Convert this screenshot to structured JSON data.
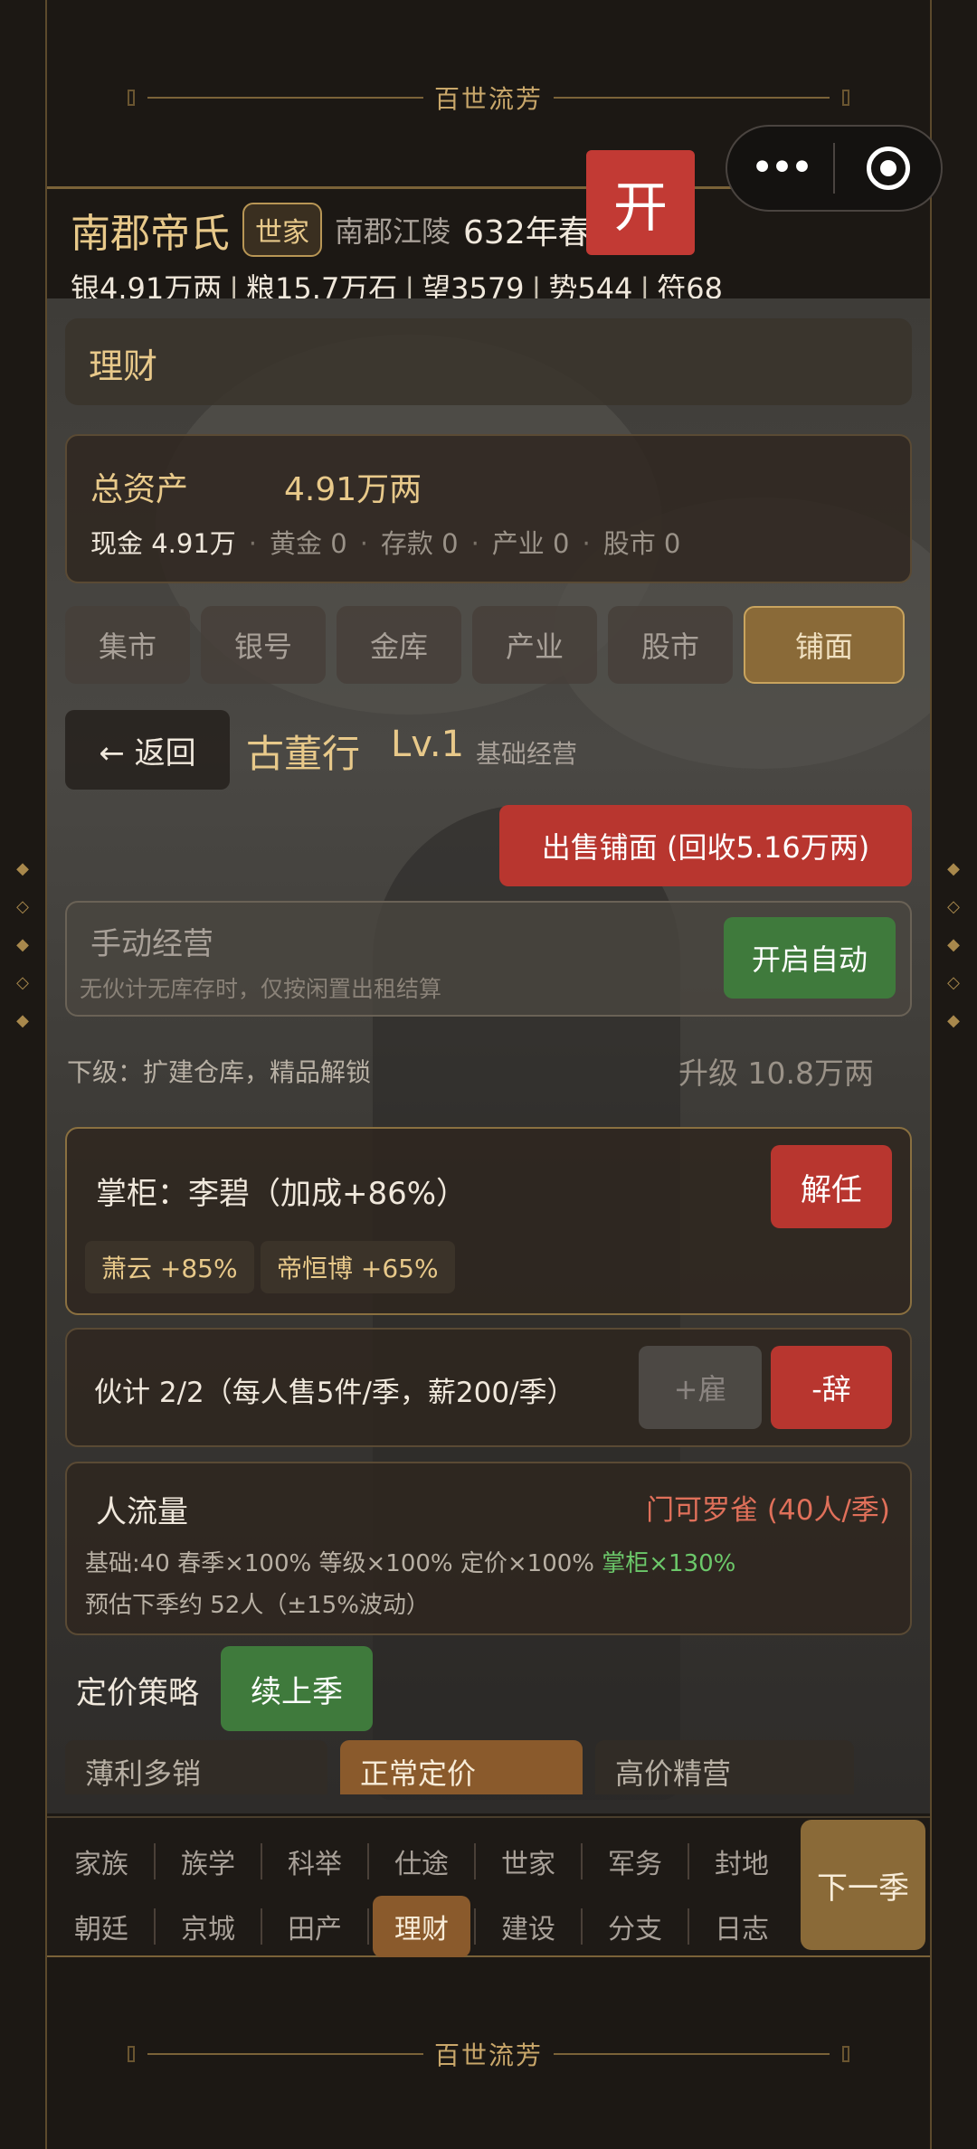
{
  "banner": {
    "top_title": "百世流芳",
    "bottom_title": "百世流芳"
  },
  "capsule": {
    "more_icon": "•••",
    "target_icon": "target-icon"
  },
  "open_button": {
    "label": "开"
  },
  "header": {
    "clan_name": "南郡帝氏",
    "rank_badge": "世家",
    "location": "南郡江陵",
    "year": "632年春",
    "resources": {
      "silver": "银4.91万两",
      "grain": "粮15.7万石",
      "prestige": "望3579",
      "power": "势544",
      "talisman": "符68"
    },
    "separator": "|"
  },
  "section": {
    "title": "理财"
  },
  "assets": {
    "total_label": "总资产",
    "total_value": "4.91万两",
    "cash": "现金 4.91万",
    "gold": "黄金 0",
    "deposit": "存款 0",
    "industry": "产业 0",
    "stock": "股市 0",
    "dot": "·"
  },
  "tabs": [
    "集市",
    "银号",
    "金库",
    "产业",
    "股市",
    "铺面"
  ],
  "active_tab": "铺面",
  "shop": {
    "back_label": "← 返回",
    "name": "古董行",
    "level": "Lv.1",
    "type": "基础经营",
    "sell_label": "出售铺面 (回收5.16万两)",
    "manual_title": "手动经营",
    "manual_desc": "无伙计无库存时，仅按闲置出租结算",
    "auto_label": "开启自动",
    "next_level": "下级：扩建仓库，精品解锁",
    "upgrade": "升级 10.8万两"
  },
  "manager": {
    "title": "掌柜：李碧（加成+86%）",
    "dismiss_label": "解任",
    "candidates": [
      "萧云 +85%",
      "帝恒博 +65%"
    ]
  },
  "staff": {
    "title": "伙计 2/2（每人售5件/季，薪200/季）",
    "hire_label": "+雇",
    "quit_label": "-辞"
  },
  "traffic": {
    "title": "人流量",
    "status": "门可罗雀 (40人/季)",
    "factors": "基础:40  春季×100%  等级×100%  定价×100%",
    "manager_factor": "掌柜×130%",
    "estimate": "预估下季约 52人（±15%波动）"
  },
  "pricing": {
    "label": "定价策略",
    "renew_label": "续上季",
    "options": [
      "薄利多销",
      "正常定价",
      "高价精营"
    ],
    "active": "正常定价"
  },
  "nav": {
    "row1": [
      "家族",
      "族学",
      "科举",
      "仕途",
      "世家",
      "军务",
      "封地"
    ],
    "row2": [
      "朝廷",
      "京城",
      "田产",
      "理财",
      "建设",
      "分支",
      "日志"
    ],
    "active": "理财",
    "next_label": "下一季"
  },
  "colors": {
    "accent_gold": "#e8c98a",
    "danger_red": "#b8362f",
    "success_green": "#3f7a3c",
    "active_brown": "#8a5a2c"
  }
}
